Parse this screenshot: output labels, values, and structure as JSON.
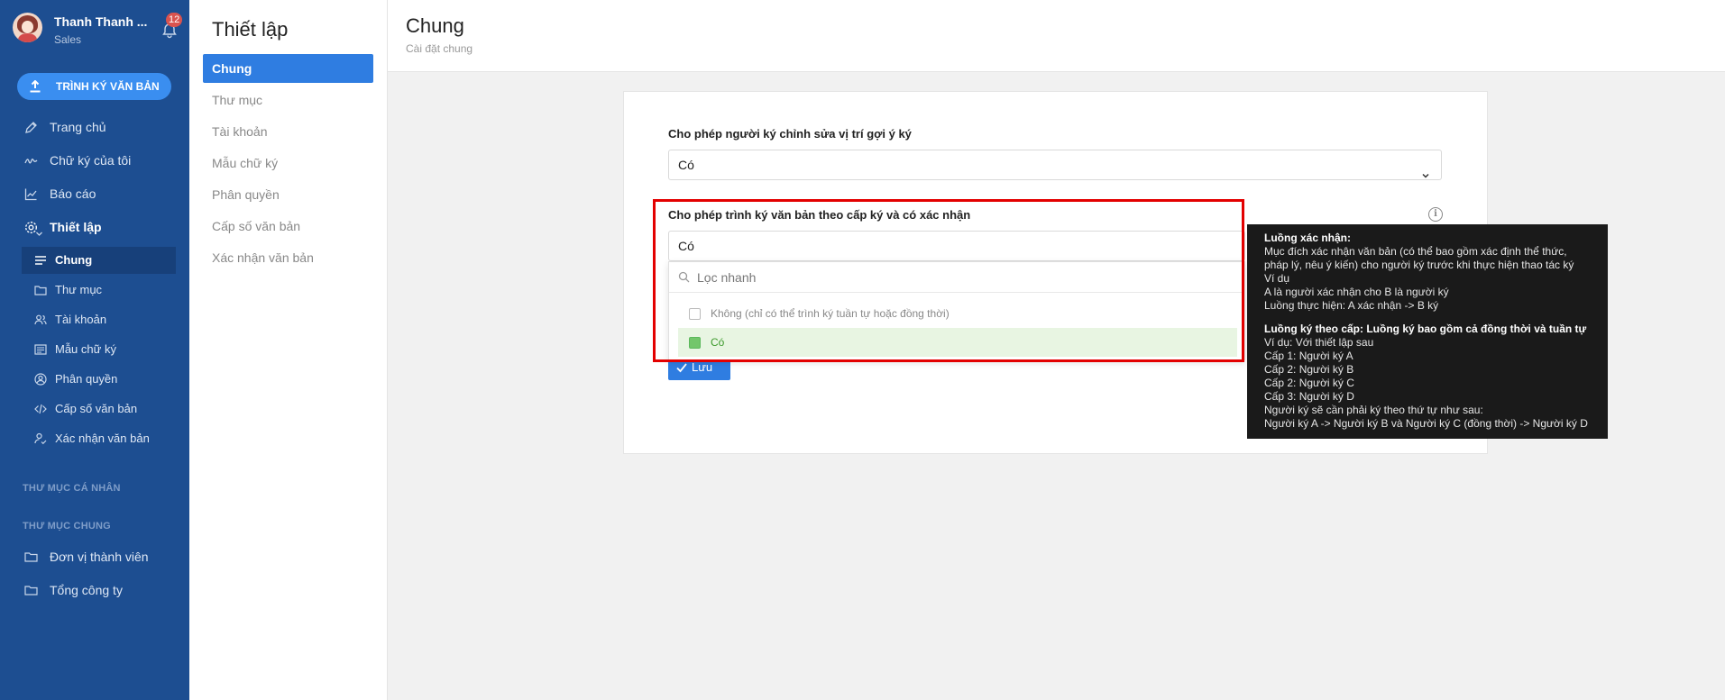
{
  "user": {
    "name": "Thanh Thanh ...",
    "role": "Sales",
    "notifications": "12"
  },
  "sidebar": {
    "primary_button": "TRÌNH KÝ VĂN BẢN",
    "nav": [
      {
        "label": "Trang chủ",
        "icon": "pen-icon"
      },
      {
        "label": "Chữ ký của tôi",
        "icon": "signature-icon"
      },
      {
        "label": "Báo cáo",
        "icon": "chart-icon"
      },
      {
        "label": "Thiết lập",
        "icon": "gear-icon"
      }
    ],
    "settings_items": [
      {
        "label": "Chung",
        "icon": "list-icon"
      },
      {
        "label": "Thư mục",
        "icon": "folder-icon"
      },
      {
        "label": "Tài khoản",
        "icon": "users-icon"
      },
      {
        "label": "Mẫu chữ ký",
        "icon": "template-icon"
      },
      {
        "label": "Phân quyền",
        "icon": "user-circle-icon"
      },
      {
        "label": "Cấp số văn bản",
        "icon": "code-icon"
      },
      {
        "label": "Xác nhận văn bản",
        "icon": "user-check-icon"
      }
    ],
    "section_personal": "THƯ MỤC CÁ NHÂN",
    "section_shared": "THƯ MỤC CHUNG",
    "shared_folders": [
      {
        "label": "Đơn vị thành viên",
        "icon": "folder-icon"
      },
      {
        "label": "Tổng công ty",
        "icon": "folder-icon"
      }
    ]
  },
  "submenu": {
    "title": "Thiết lập",
    "items": [
      "Chung",
      "Thư mục",
      "Tài khoản",
      "Mẫu chữ ký",
      "Phân quyền",
      "Cấp số văn bản",
      "Xác nhận văn bản"
    ],
    "active": "Chung"
  },
  "page": {
    "title": "Chung",
    "subtitle": "Cài đặt chung"
  },
  "form": {
    "field1": {
      "label": "Cho phép người ký chỉnh sửa vị trí gợi ý ký",
      "value": "Có"
    },
    "field2": {
      "label": "Cho phép trình ký văn bản theo cấp ký và có xác nhận",
      "value": "Có",
      "search_placeholder": "Lọc nhanh",
      "options": [
        {
          "label": "Không (chỉ có thể trình ký tuần tự hoặc đồng thời)",
          "selected": false
        },
        {
          "label": "Có",
          "selected": true
        }
      ]
    },
    "save_label": "Lưu"
  },
  "tooltip": {
    "heading1": "Luồng xác nhận:",
    "lines1": [
      "Mục đích xác nhận văn bản (có thể bao gồm xác định thể thức,",
      "pháp lý, nêu ý kiến) cho người ký trước khi thực hiện thao tác ký",
      "Ví dụ",
      "A là người xác nhận cho B là người ký",
      "Luồng thực hiện: A xác nhận -> B ký"
    ],
    "heading2": "Luồng ký theo cấp: Luồng ký bao gồm cả đồng thời và tuần tự",
    "lines2": [
      "Ví dụ: Với thiết lập sau",
      "Cấp 1: Người ký A",
      "Cấp 2: Người ký B",
      "Cấp 2: Người ký C",
      "Cấp 3: Người ký D",
      "Người ký sẽ cần phải ký theo thứ tự như sau:",
      "Người ký A -> Người ký B và Người ký C (đồng thời) -> Người ký D"
    ]
  },
  "colors": {
    "sidebar_bg": "#1d4e91",
    "accent": "#2f7de1",
    "highlight_border": "#e30000",
    "selected_option": "#3c9a2c"
  }
}
